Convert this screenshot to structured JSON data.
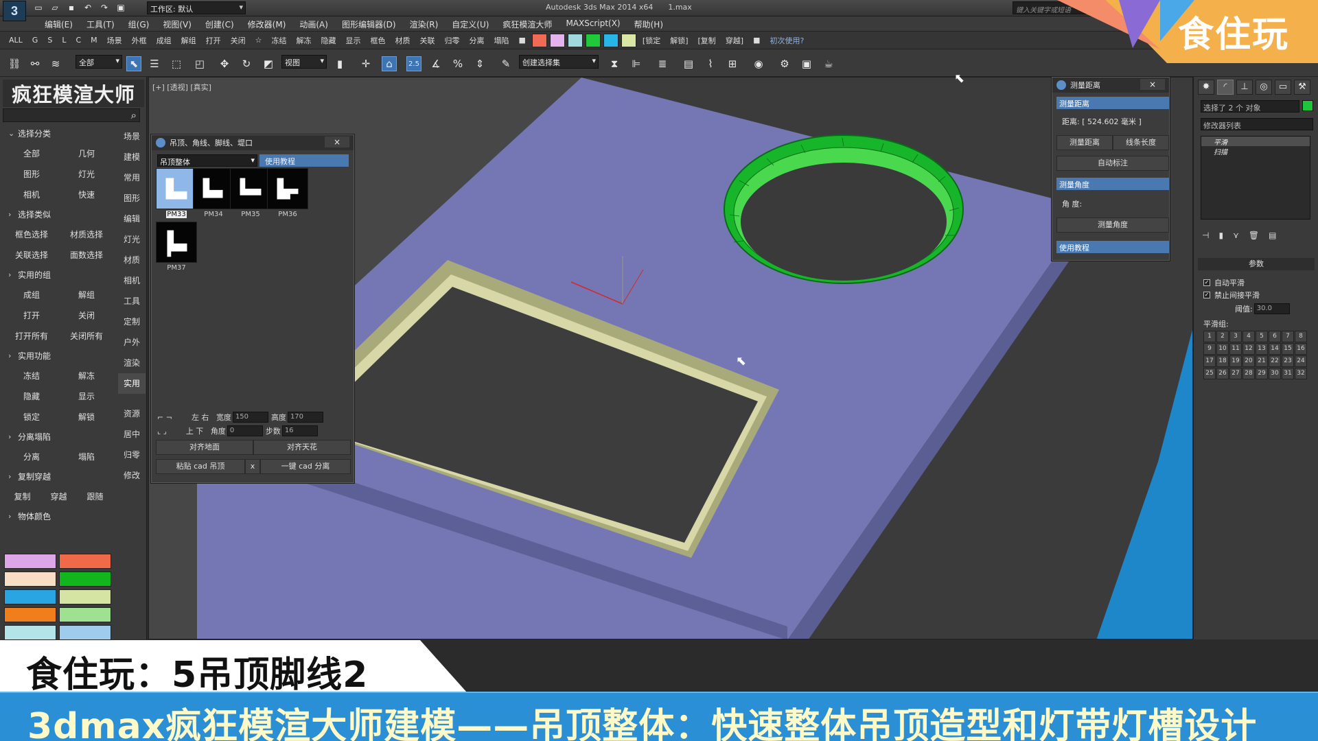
{
  "titlebar": {
    "workspace": "工作区: 默认",
    "app_title": "Autodesk 3ds Max  2014 x64",
    "file_name": "1.max",
    "search_placeholder": "键入关键字或短语"
  },
  "menu": [
    "编辑(E)",
    "工具(T)",
    "组(G)",
    "视图(V)",
    "创建(C)",
    "修改器(M)",
    "动画(A)",
    "图形编辑器(D)",
    "渲染(R)",
    "自定义(U)",
    "疯狂模渲大师",
    "MAXScript(X)",
    "帮助(H)"
  ],
  "plugin_bar": {
    "items": [
      "ALL",
      "G",
      "S",
      "L",
      "C",
      "M",
      "场景",
      "外框",
      "成组",
      "解组",
      "打开",
      "关闭",
      "☆",
      "冻结",
      "解冻",
      "隐藏",
      "显示",
      "框色",
      "材质",
      "关联",
      "归零",
      "分离",
      "塌陷"
    ],
    "swatches": [
      "#f06a55",
      "#e4b3ee",
      "#9fd9de",
      "#1fc93b",
      "#27b6e6",
      "#d9e7a6"
    ],
    "right_items": [
      "[锁定",
      "解锁]",
      "[复制",
      "穿越]"
    ],
    "help": "初次使用?"
  },
  "toolbar": {
    "filter": "全部",
    "ref_coord": "视图",
    "snap_value": "2.5",
    "named_sel": "创建选择集"
  },
  "left_panel": {
    "title": "疯狂模渲大师",
    "sections": [
      {
        "label": "选择分类",
        "rows": [
          [
            "全部",
            "几何"
          ],
          [
            "图形",
            "灯光"
          ],
          [
            "相机",
            "快速"
          ]
        ]
      },
      {
        "label": "选择类似",
        "rows": [
          [
            "框色选择",
            "材质选择"
          ],
          [
            "关联选择",
            "面数选择"
          ]
        ]
      },
      {
        "label": "实用的组",
        "rows": [
          [
            "成组",
            "解组"
          ],
          [
            "打开",
            "关闭"
          ],
          [
            "打开所有",
            "关闭所有"
          ]
        ]
      },
      {
        "label": "实用功能",
        "rows": [
          [
            "冻结",
            "解冻"
          ],
          [
            "隐藏",
            "显示"
          ],
          [
            "锁定",
            "解锁"
          ]
        ]
      },
      {
        "label": "分离塌陷",
        "rows": [
          [
            "分离",
            "塌陷"
          ]
        ]
      },
      {
        "label": "复制穿越",
        "rows": [
          [
            "复制",
            "穿越",
            "跟随"
          ]
        ]
      },
      {
        "label": "物体颜色",
        "rows": []
      }
    ],
    "colors": [
      "#dda6e8",
      "#f06a4a",
      "#f8dec4",
      "#13b51c",
      "#2aa5e3",
      "#d5e3a3",
      "#f07e1d",
      "#9fe091",
      "#b4e3e8",
      "#9fccec"
    ],
    "tabs": [
      "场景",
      "建模",
      "常用",
      "图形",
      "编辑",
      "灯光",
      "材质",
      "相机",
      "工具",
      "定制",
      "户外",
      "渲染",
      "实用",
      "资源",
      "居中",
      "归零",
      "修改"
    ],
    "active_tab": "实用"
  },
  "viewport": {
    "label": "[+] [透视] [真实]"
  },
  "ceiling_window": {
    "title": "吊顶、角线、脚线、堤口",
    "close": "×",
    "preset": "吊顶整体",
    "tutorial": "使用教程",
    "thumbs": [
      "PM33",
      "PM34",
      "PM35",
      "PM36",
      "PM37"
    ],
    "selected_thumb": "PM33",
    "lr": "左 右",
    "ud": "上 下",
    "width_label": "宽度",
    "width": "150",
    "height_label": "高度",
    "height": "170",
    "angle_label": "角度",
    "angle": "0",
    "steps_label": "步数",
    "steps": "16",
    "align_floor": "对齐地面",
    "align_ceiling": "对齐天花",
    "paste_cad": "粘贴 cad 吊顶",
    "x_btn": "x",
    "split_cad": "一键 cad 分离"
  },
  "measure_window": {
    "title": "测量距离",
    "close": "×",
    "sec_dist": "测量距离",
    "distance": "距离: [ 524.602 毫米 ]",
    "btn_measure": "测量距离",
    "btn_line": "线条长度",
    "btn_auto": "自动标注",
    "sec_angle": "测量角度",
    "angle_label": "角 度:",
    "btn_angle": "测量角度",
    "sec_tut": "使用教程"
  },
  "command_panel": {
    "selection": "选择了 2 个 对象",
    "modifier_list": "修改器列表",
    "stack": [
      "平滑",
      "扫描"
    ],
    "params": "参数",
    "auto_smooth": "自动平滑",
    "no_indirect": "禁止间接平滑",
    "threshold_label": "阈值:",
    "threshold": "30.0",
    "smooth_groups": "平滑组:",
    "groups": [
      "1",
      "2",
      "3",
      "4",
      "5",
      "6",
      "7",
      "8",
      "9",
      "10",
      "11",
      "12",
      "13",
      "14",
      "15",
      "16",
      "17",
      "18",
      "19",
      "20",
      "21",
      "22",
      "23",
      "24",
      "25",
      "26",
      "27",
      "28",
      "29",
      "30",
      "31",
      "32"
    ]
  },
  "brand": "食住玩",
  "subtitle_top": "食住玩：5吊顶脚线2",
  "subtitle_bottom": "3dmax疯狂模渲大师建模——吊顶整体：快速整体吊顶造型和灯带灯槽设计"
}
